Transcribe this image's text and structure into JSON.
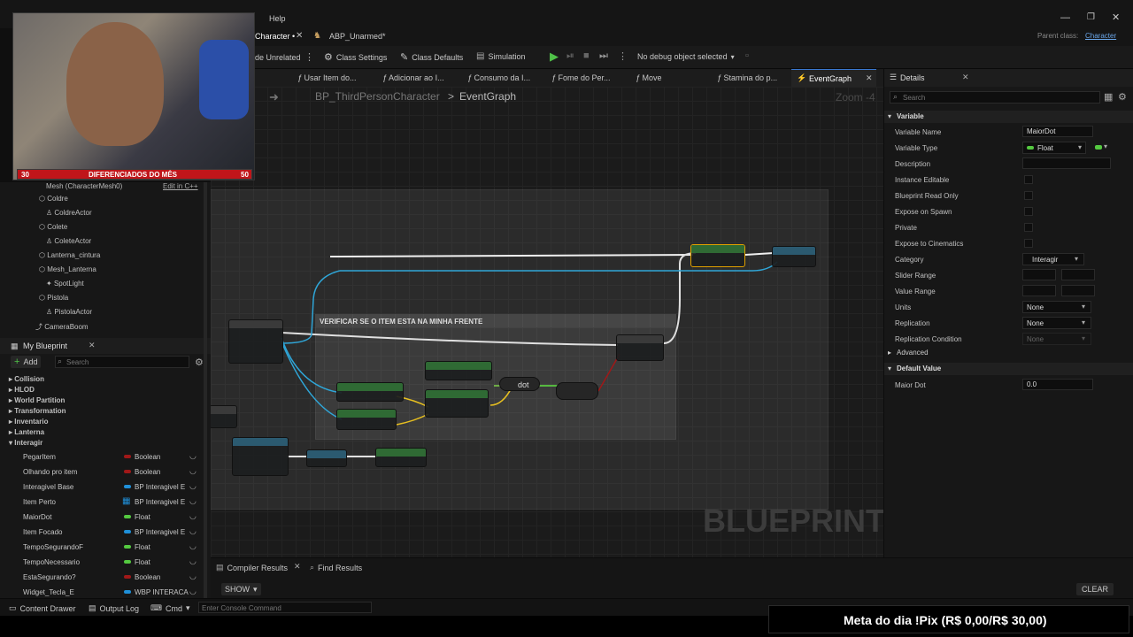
{
  "window": {
    "menu_help": "Help",
    "parent_class_label": "Parent class:",
    "parent_class_value": "Character"
  },
  "tabs": [
    {
      "label": "Character",
      "modified": "•"
    },
    {
      "label": "ABP_Unarmed*"
    }
  ],
  "toolbar": {
    "hide_unrelated": "de Unrelated",
    "class_settings": "Class Settings",
    "class_defaults": "Class Defaults",
    "simulation": "Simulation",
    "debug_select": "No debug object selected"
  },
  "function_tabs": [
    {
      "label": "Usar Item do..."
    },
    {
      "label": "Adicionar ao I..."
    },
    {
      "label": "Consumo da I..."
    },
    {
      "label": "Fome do Per..."
    },
    {
      "label": "Move"
    },
    {
      "label": "Stamina do p..."
    },
    {
      "label": "EventGraph",
      "active": true
    }
  ],
  "graph": {
    "breadcrumb_root": "BP_ThirdPersonCharacter",
    "breadcrumb_sep": ">",
    "breadcrumb_leaf": "EventGraph",
    "zoom": "Zoom -4",
    "watermark": "BLUEPRINT",
    "comment_title": "VERIFICAR SE O ITEM ESTA NA MINHA FRENTE",
    "dot_label": "dot"
  },
  "webcam": {
    "goal_start": "30",
    "goal_label": "DIFERENCIADOS DO MÊS",
    "goal_end": "50"
  },
  "components": {
    "header_partial": "Mesh (CharacterMesh0)",
    "edit_cpp": "Edit in C++",
    "items": [
      {
        "label": "Coldre",
        "indent": 1,
        "icon": "mesh-icon"
      },
      {
        "label": "ColdreActor",
        "indent": 2,
        "icon": "actor-icon"
      },
      {
        "label": "Colete",
        "indent": 1,
        "icon": "mesh-icon"
      },
      {
        "label": "ColeteActor",
        "indent": 2,
        "icon": "actor-icon"
      },
      {
        "label": "Lanterna_cintura",
        "indent": 1,
        "icon": "mesh-icon"
      },
      {
        "label": "Mesh_Lanterna",
        "indent": 1,
        "icon": "mesh-icon"
      },
      {
        "label": "SpotLight",
        "indent": 2,
        "icon": "light-icon"
      },
      {
        "label": "Pistola",
        "indent": 1,
        "icon": "mesh-icon"
      },
      {
        "label": "PistolaActor",
        "indent": 2,
        "icon": "actor-icon"
      },
      {
        "label": "CameraBoom",
        "indent": 0,
        "icon": "camera-icon"
      }
    ]
  },
  "my_blueprint": {
    "title": "My Blueprint",
    "add_label": "Add",
    "search_placeholder": "Search",
    "categories": [
      "Collision",
      "HLOD",
      "World Partition",
      "Transformation",
      "Inventario",
      "Lanterna",
      "Interagir"
    ],
    "variables": [
      {
        "name": "PegarItem",
        "type": "Boolean",
        "color": "#a01818"
      },
      {
        "name": "Olhando pro item",
        "type": "Boolean",
        "color": "#a01818"
      },
      {
        "name": "Interagivel Base",
        "type": "BP Interagivel E",
        "color": "#1f8fd8"
      },
      {
        "name": "Item Perto",
        "type": "BP Interagivel E",
        "color": "#1f8fd8",
        "array": true
      },
      {
        "name": "MaiorDot",
        "type": "Float",
        "color": "#54c940"
      },
      {
        "name": "Item Focado",
        "type": "BP Interagivel E",
        "color": "#1f8fd8"
      },
      {
        "name": "TempoSegurandoF",
        "type": "Float",
        "color": "#54c940"
      },
      {
        "name": "TempoNecessario",
        "type": "Float",
        "color": "#54c940"
      },
      {
        "name": "EstaSegurando?",
        "type": "Boolean",
        "color": "#a01818"
      },
      {
        "name": "Widget_Tecla_E",
        "type": "WBP INTERACA",
        "color": "#1f8fd8"
      }
    ]
  },
  "details": {
    "title": "Details",
    "search_placeholder": "Search",
    "section_variable": "Variable",
    "section_advanced": "Advanced",
    "section_default": "Default Value",
    "rows": {
      "variable_name": {
        "label": "Variable Name",
        "value": "MaiorDot"
      },
      "variable_type": {
        "label": "Variable Type",
        "value": "Float"
      },
      "description": {
        "label": "Description"
      },
      "instance_editable": {
        "label": "Instance Editable"
      },
      "blueprint_read_only": {
        "label": "Blueprint Read Only"
      },
      "expose_on_spawn": {
        "label": "Expose on Spawn"
      },
      "private": {
        "label": "Private"
      },
      "expose_to_cinematics": {
        "label": "Expose to Cinematics"
      },
      "category": {
        "label": "Category",
        "value": "Interagir"
      },
      "slider_range": {
        "label": "Slider Range"
      },
      "value_range": {
        "label": "Value Range"
      },
      "units": {
        "label": "Units",
        "value": "None"
      },
      "replication": {
        "label": "Replication",
        "value": "None"
      },
      "replication_condition": {
        "label": "Replication Condition",
        "value": "None"
      },
      "maior_dot": {
        "label": "Maior Dot",
        "value": "0.0"
      }
    }
  },
  "bottom": {
    "compiler_results": "Compiler Results",
    "find_results": "Find Results",
    "show_label": "SHOW",
    "clear_label": "CLEAR"
  },
  "statusbar": {
    "content_drawer": "Content Drawer",
    "output_log": "Output Log",
    "cmd": "Cmd",
    "console_placeholder": "Enter Console Command"
  },
  "overlay": {
    "pix_goal": "Meta do dia !Pix (R$ 0,00/R$ 30,00)"
  },
  "colors": {
    "float": "#54c940",
    "boolean": "#a01818",
    "object": "#1f8fd8",
    "node_select": "#e0a000"
  }
}
